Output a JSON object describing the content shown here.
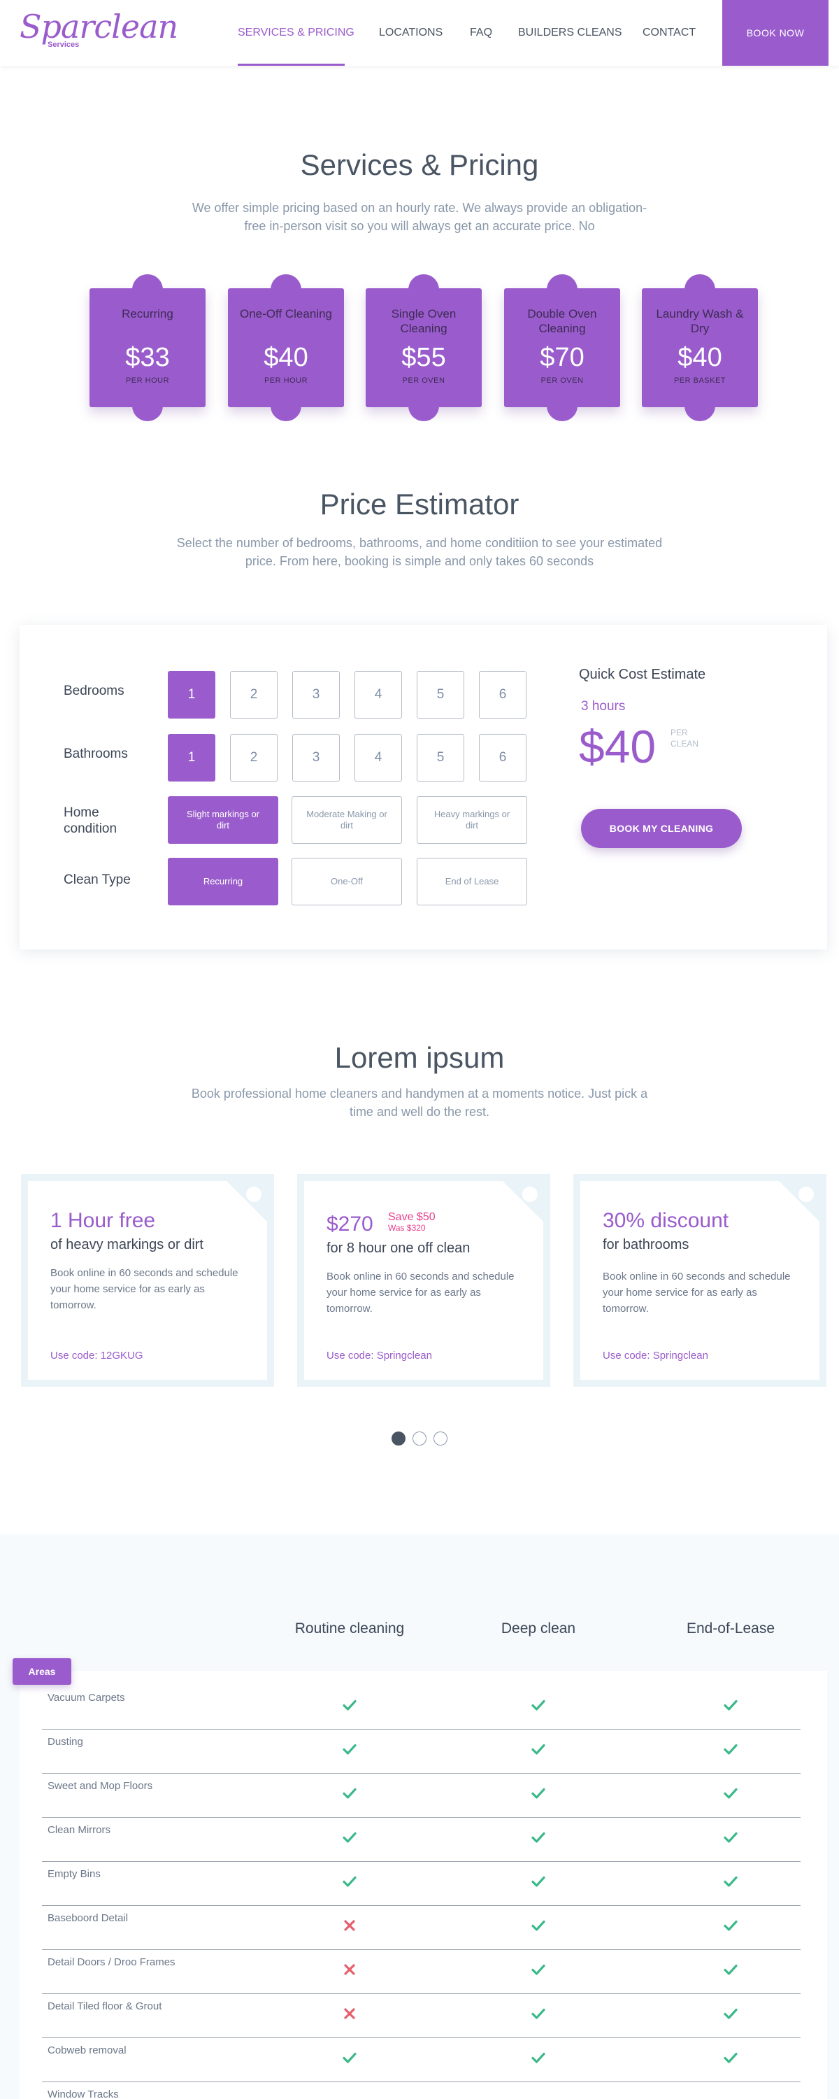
{
  "header": {
    "logo": "Sparclean",
    "logo_sub": "Services",
    "nav": [
      "SERVICES & PRICING",
      "LOCATIONS",
      "FAQ",
      "BUILDERS CLEANS",
      "CONTACT"
    ],
    "book_now": "BOOK NOW"
  },
  "services": {
    "title": "Services & Pricing",
    "subtitle": "We offer simple pricing based on an hourly rate. We always provide an obligation-free in-person visit so you will always get an accurate price. No",
    "cards": [
      {
        "name": "Recurring",
        "price": "$33",
        "unit": "PER HOUR"
      },
      {
        "name": "One-Off Cleaning",
        "price": "$40",
        "unit": "PER HOUR"
      },
      {
        "name": "Single Oven Cleaning",
        "price": "$55",
        "unit": "PER OVEN"
      },
      {
        "name": "Double Oven Cleaning",
        "price": "$70",
        "unit": "PER OVEN"
      },
      {
        "name": "Laundry Wash & Dry",
        "price": "$40",
        "unit": "PER BASKET"
      }
    ]
  },
  "estimator": {
    "title": "Price Estimator",
    "subtitle": "Select the number of bedrooms, bathrooms, and home conditiion to see your estimated price. From here, booking is simple and only takes 60 seconds",
    "bedrooms_label": "Bedrooms",
    "bathrooms_label": "Bathrooms",
    "condition_label": "Home condition",
    "type_label": "Clean Type",
    "numbers": [
      "1",
      "2",
      "3",
      "4",
      "5",
      "6"
    ],
    "selected_bedrooms": "1",
    "selected_bathrooms": "1",
    "conditions": [
      "Slight markings or dirt",
      "Moderate Making or dirt",
      "Heavy markings or dirt"
    ],
    "selected_condition": "Slight markings or dirt",
    "types": [
      "Recurring",
      "One-Off",
      "End of Lease"
    ],
    "selected_type": "Recurring",
    "quick_title": "Quick Cost Estimate",
    "hours": "3 hours",
    "price": "$40",
    "per": "PER CLEAN",
    "book_button": "BOOK MY CLEANING"
  },
  "promos": {
    "title": "Lorem ipsum",
    "subtitle": "Book professional home cleaners and handymen at a moments notice. Just pick a time and well do the rest.",
    "cards": [
      {
        "headline": "1 Hour free",
        "sub": "of heavy markings or dirt",
        "body": "Book online in 60 seconds and schedule your home service for as early as tomorrow.",
        "code": "Use code: 12GKUG"
      },
      {
        "headline": "$270",
        "save": "Save $50",
        "was": "Was $320",
        "sub": "for 8 hour one off clean",
        "body": "Book online in 60 seconds and schedule your home service for as early as tomorrow.",
        "code": "Use code: Springclean"
      },
      {
        "headline": "30% discount",
        "sub": "for bathrooms",
        "body": "Book online in 60 seconds and schedule your home service for as early as tomorrow.",
        "code": "Use code: Springclean"
      }
    ],
    "carousel_active": 0,
    "carousel_count": 3
  },
  "comparison": {
    "areas_label": "Areas",
    "columns": [
      "Routine cleaning",
      "Deep clean",
      "End-of-Lease"
    ],
    "rows": [
      {
        "label": "Vacuum Carpets",
        "values": [
          true,
          true,
          true
        ]
      },
      {
        "label": "Dusting",
        "values": [
          true,
          true,
          true
        ]
      },
      {
        "label": "Sweet and Mop Floors",
        "values": [
          true,
          true,
          true
        ]
      },
      {
        "label": "Clean Mirrors",
        "values": [
          true,
          true,
          true
        ]
      },
      {
        "label": "Empty Bins",
        "values": [
          true,
          true,
          true
        ]
      },
      {
        "label": "Baseboord Detail",
        "values": [
          false,
          true,
          true
        ]
      },
      {
        "label": "Detail Doors / Droo Frames",
        "values": [
          false,
          true,
          true
        ]
      },
      {
        "label": "Detail Tiled floor & Grout",
        "values": [
          false,
          true,
          true
        ]
      },
      {
        "label": "Cobweb removal",
        "values": [
          true,
          true,
          true
        ]
      },
      {
        "label": "Window Tracks",
        "values": []
      }
    ],
    "colors": {
      "check": "#3cb88a",
      "cross": "#e4606d"
    }
  }
}
